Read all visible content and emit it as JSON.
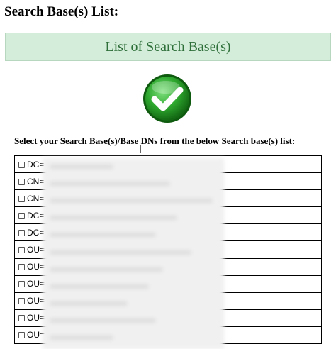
{
  "page": {
    "title": "Search Base(s) List:"
  },
  "banner": {
    "text": "List of Search Base(s)"
  },
  "status_icon": "checkmark-success-icon",
  "instruction": "Select your Search Base(s)/Base DNs from the below Search base(s) list:",
  "colors": {
    "banner_bg": "#d4edda",
    "banner_text": "#2f6f3a",
    "check_green": "#2ea82e"
  },
  "rows": [
    {
      "label": "DC=",
      "checked": false
    },
    {
      "label": "CN=",
      "checked": false
    },
    {
      "label": "CN=",
      "checked": false
    },
    {
      "label": "DC=",
      "checked": false
    },
    {
      "label": "DC=",
      "checked": false
    },
    {
      "label": "OU=",
      "checked": false
    },
    {
      "label": "OU=",
      "checked": false
    },
    {
      "label": "OU=",
      "checked": false
    },
    {
      "label": "OU=",
      "checked": false
    },
    {
      "label": "OU=",
      "checked": false
    },
    {
      "label": "OU=",
      "checked": false
    }
  ]
}
